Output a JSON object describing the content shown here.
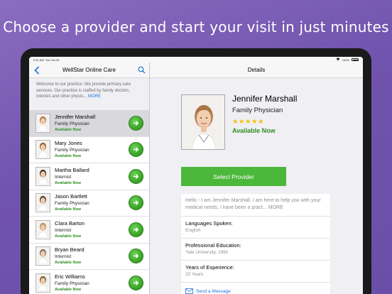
{
  "headline": "Choose a provider and start your visit in just minutes",
  "status_bar": {
    "time": "9:41 AM",
    "date": "Tue Oct 30",
    "battery": "100%"
  },
  "left_panel": {
    "title": "WellStar Online Care",
    "intro": "Welcome to our practice. We provide primary care services. Our practice is staffed by family doctors, interists and other physic...",
    "intro_more": "MORE",
    "providers": [
      {
        "name": "Jennifer Marshall",
        "title": "Family Physician",
        "status": "Available Now",
        "selected": true
      },
      {
        "name": "Mary Jones",
        "title": "Family Physician",
        "status": "Available Now",
        "selected": false
      },
      {
        "name": "Martha Ballard",
        "title": "Internist",
        "status": "Available Now",
        "selected": false
      },
      {
        "name": "Jason Bartlett",
        "title": "Family Physician",
        "status": "Available Now",
        "selected": false
      },
      {
        "name": "Clara Barton",
        "title": "Internist",
        "status": "Available Now",
        "selected": false
      },
      {
        "name": "Bryan Beard",
        "title": "Internist",
        "status": "Available Now",
        "selected": false
      },
      {
        "name": "Eric Williams",
        "title": "Family Physician",
        "status": "Available Now",
        "selected": false
      }
    ]
  },
  "details": {
    "nav_title": "Details",
    "name": "Jennifer Marshall",
    "title": "Family Physician",
    "rating_stars": "★★★★★",
    "status": "Available Now",
    "select_button": "Select Provider",
    "bio": "Hello - I am Jennifer Marshall. I am here to help you with your medical needs. I have been a pract...",
    "bio_more": "MORE",
    "fields": [
      {
        "label": "Languages Spoken:",
        "value": "English"
      },
      {
        "label": "Professional Education:",
        "value": "Yale University, 1991"
      },
      {
        "label": "Years of Experience:",
        "value": "20 Years"
      }
    ],
    "send_message": "Send a Message"
  },
  "colors": {
    "accent_green": "#4cb83b",
    "link_blue": "#1a73d9",
    "available_green": "#2f8f1f",
    "background_purple": "#7053ad"
  }
}
